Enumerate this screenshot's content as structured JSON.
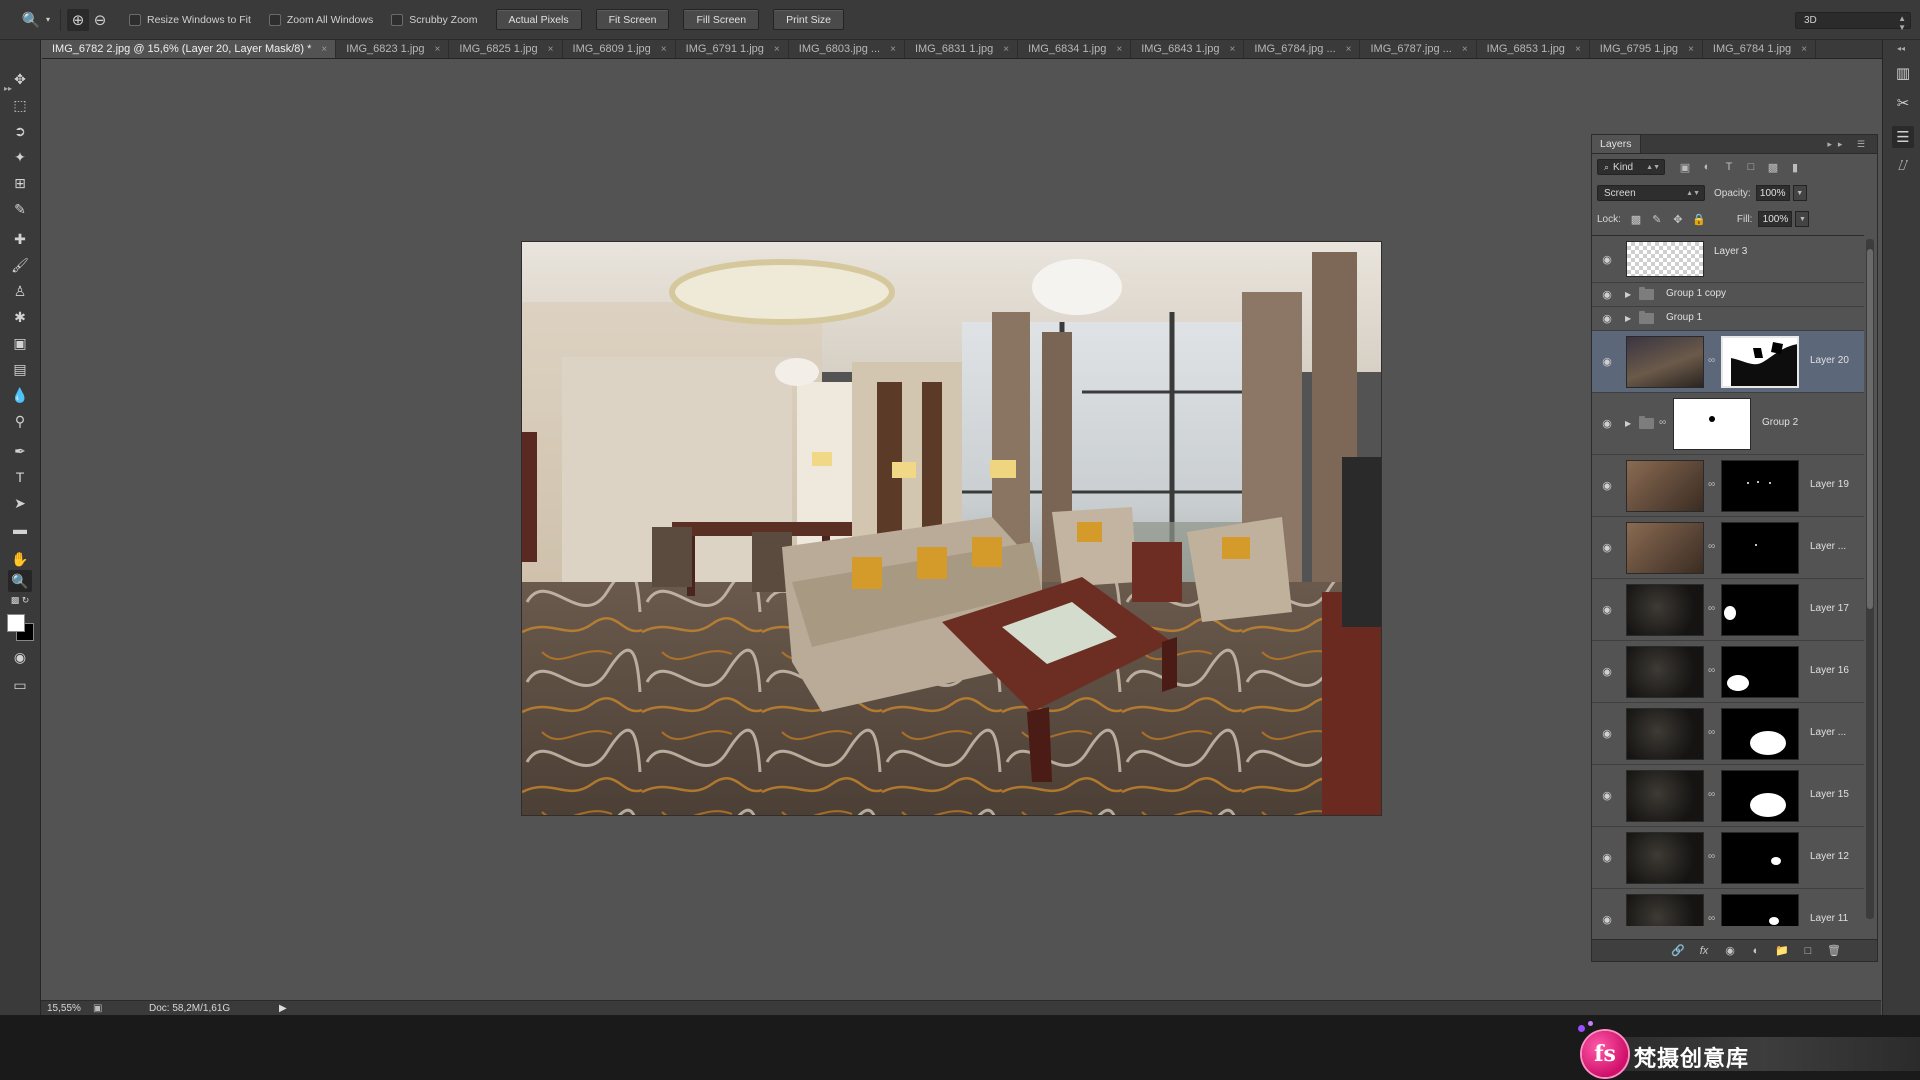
{
  "options_bar": {
    "resize_windows_label": "Resize Windows to Fit",
    "zoom_all_label": "Zoom All Windows",
    "scrubby_zoom_label": "Scrubby Zoom",
    "buttons": [
      "Actual Pixels",
      "Fit Screen",
      "Fill Screen",
      "Print Size"
    ],
    "workspace": "3D"
  },
  "tabs": [
    {
      "label": "IMG_6782 2.jpg @ 15,6% (Layer 20, Layer Mask/8) *",
      "active": true
    },
    {
      "label": "IMG_6823 1.jpg"
    },
    {
      "label": "IMG_6825 1.jpg"
    },
    {
      "label": "IMG_6809 1.jpg"
    },
    {
      "label": "IMG_6791 1.jpg"
    },
    {
      "label": "IMG_6803.jpg ..."
    },
    {
      "label": "IMG_6831 1.jpg"
    },
    {
      "label": "IMG_6834 1.jpg"
    },
    {
      "label": "IMG_6843 1.jpg"
    },
    {
      "label": "IMG_6784.jpg ..."
    },
    {
      "label": "IMG_6787.jpg ..."
    },
    {
      "label": "IMG_6853 1.jpg"
    },
    {
      "label": "IMG_6795 1.jpg"
    },
    {
      "label": "IMG_6784 1.jpg"
    }
  ],
  "status": {
    "zoom": "15,55%",
    "doc": "Doc: 58,2M/1,61G"
  },
  "layers_panel": {
    "title": "Layers",
    "filter_kind": "Kind",
    "blend_mode": "Screen",
    "opacity_label": "Opacity:",
    "opacity": "100%",
    "lock_label": "Lock:",
    "fill_label": "Fill:",
    "fill": "100%",
    "layers": [
      {
        "name": "Layer 3",
        "kind": "transparent"
      },
      {
        "name": "Group 1 copy",
        "kind": "group"
      },
      {
        "name": "Group 1",
        "kind": "group"
      },
      {
        "name": "Layer 20",
        "kind": "masked",
        "selected": true
      },
      {
        "name": "Group 2",
        "kind": "group-mask"
      },
      {
        "name": "Layer 19",
        "kind": "masked"
      },
      {
        "name": "Layer ...",
        "kind": "masked"
      },
      {
        "name": "Layer 17",
        "kind": "masked"
      },
      {
        "name": "Layer 16",
        "kind": "masked"
      },
      {
        "name": "Layer ...",
        "kind": "masked"
      },
      {
        "name": "Layer 15",
        "kind": "masked"
      },
      {
        "name": "Layer 12",
        "kind": "masked"
      },
      {
        "name": "Layer 11",
        "kind": "masked"
      }
    ]
  },
  "watermark": {
    "logo": "fs",
    "text": "梵摄创意库"
  }
}
